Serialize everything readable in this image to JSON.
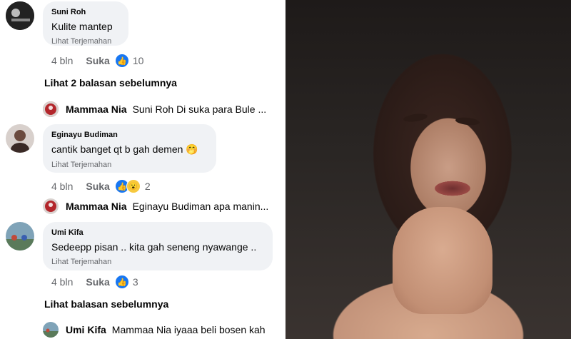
{
  "comments": [
    {
      "author": "Suni Roh",
      "text": "Kulite mantep",
      "translate": "Lihat Terjemahan",
      "age": "4 bln",
      "like_label": "Suka",
      "reaction_count": "10",
      "reactions": [
        "like-icon"
      ]
    },
    {
      "author": "Eginayu Budiman",
      "text": "cantik banget qt b gah demen 🤭",
      "translate": "Lihat Terjemahan",
      "age": "4 bln",
      "like_label": "Suka",
      "reaction_count": "2",
      "reactions": [
        "like-icon",
        "wow-icon"
      ]
    },
    {
      "author": "Umi Kifa",
      "text": "Sedeepp pisan .. kita gah seneng nyawange ..",
      "translate": "Lihat Terjemahan",
      "age": "4 bln",
      "like_label": "Suka",
      "reaction_count": "3",
      "reactions": [
        "like-icon"
      ]
    }
  ],
  "more_replies_1": "Lihat 2 balasan sebelumnya",
  "more_replies_2": "Lihat balasan sebelumnya",
  "replies": [
    {
      "author": "Mammaa Nia",
      "text": "Suni Roh Di suka para Bule ..."
    },
    {
      "author": "Mammaa Nia",
      "text": "Eginayu Budiman apa manin..."
    },
    {
      "author": "Umi Kifa",
      "text": "Mammaa Nia iyaaa beli bosen kah"
    }
  ],
  "colors": {
    "like_blue": "#1877f2",
    "bubble_bg": "#f0f2f5",
    "muted": "#65676b"
  }
}
